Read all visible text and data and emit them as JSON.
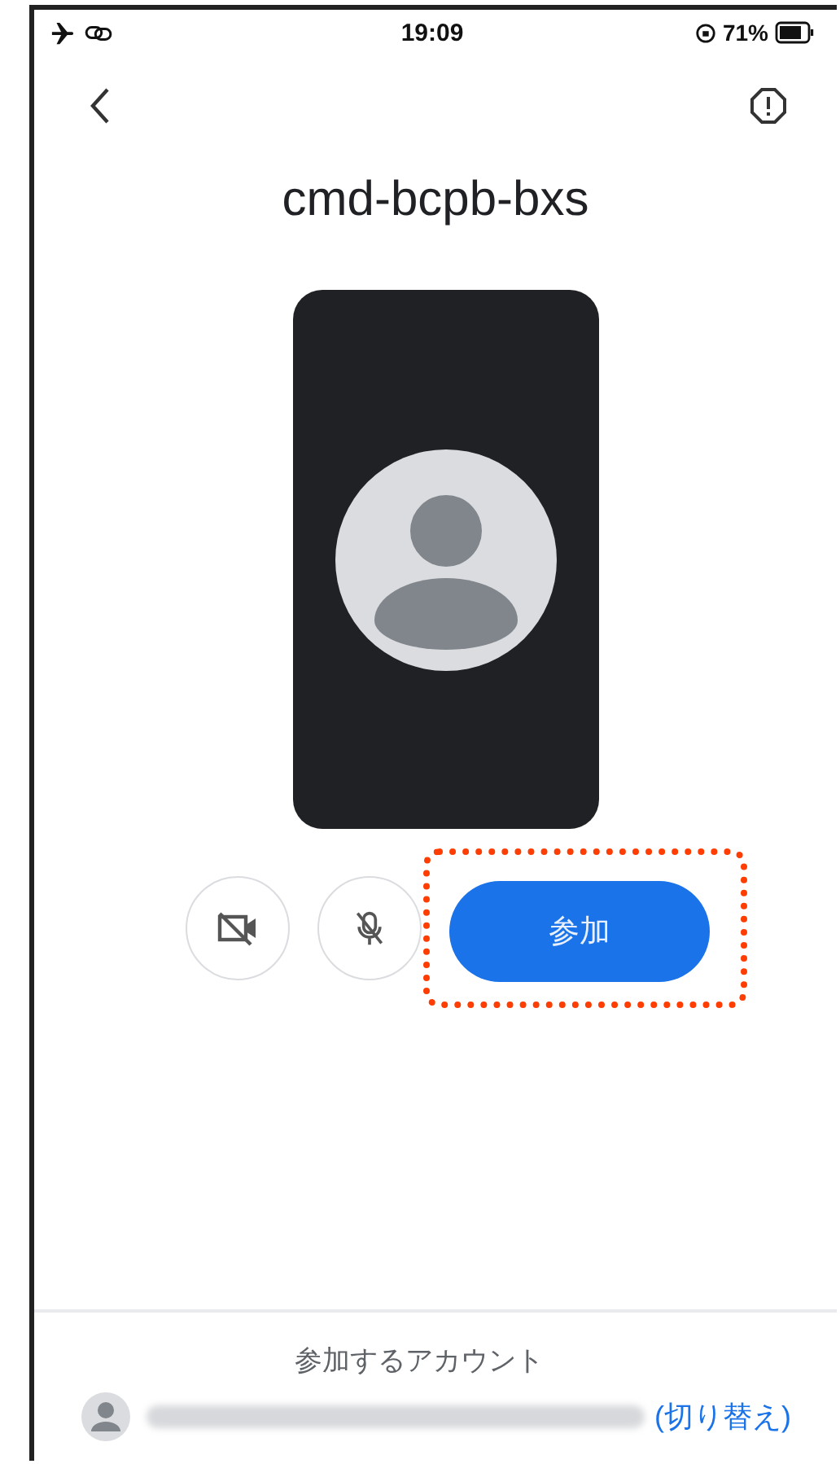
{
  "status_bar": {
    "time": "19:09",
    "battery": "71%"
  },
  "meeting": {
    "code": "cmd-bcpb-bxs"
  },
  "controls": {
    "camera_off": true,
    "mic_off": true,
    "join_label": "参加",
    "join_highlighted": true
  },
  "account": {
    "label": "参加するアカウント",
    "switch_link": "(切り替え)"
  }
}
